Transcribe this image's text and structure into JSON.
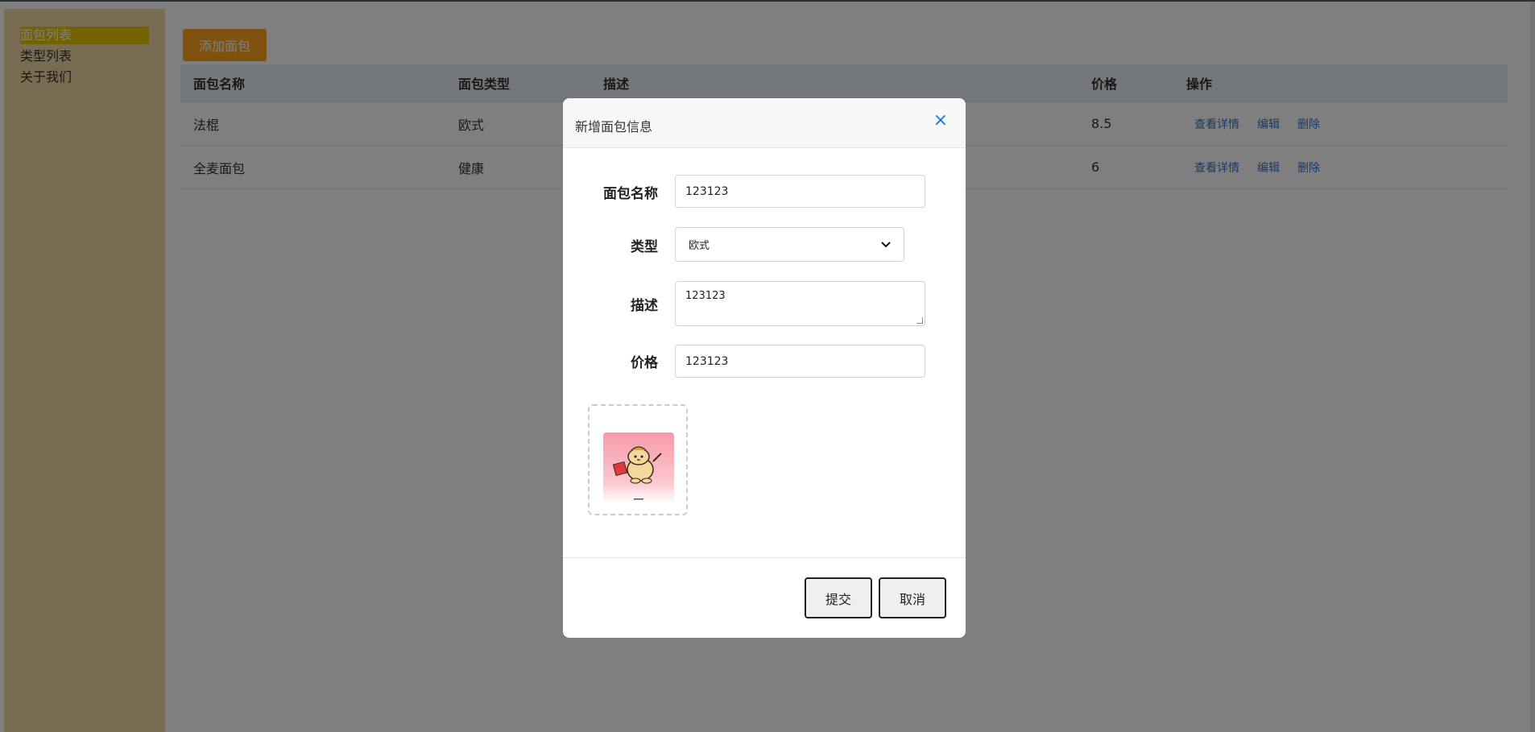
{
  "sidebar": {
    "items": [
      {
        "label": "面包列表",
        "active": true
      },
      {
        "label": "类型列表",
        "active": false
      },
      {
        "label": "关于我们",
        "active": false
      }
    ]
  },
  "toolbar": {
    "add_label": "添加面包"
  },
  "table": {
    "headers": [
      "面包名称",
      "面包类型",
      "描述",
      "价格",
      "操作"
    ],
    "rows": [
      {
        "name": "法棍",
        "type": "欧式",
        "desc": "",
        "price": "8.5"
      },
      {
        "name": "全麦面包",
        "type": "健康",
        "desc": "",
        "price": "6"
      }
    ],
    "actions": [
      "查看详情",
      "编辑",
      "删除"
    ]
  },
  "modal": {
    "title": "新增面包信息",
    "close_icon": "close-icon",
    "fields": {
      "name": {
        "label": "面包名称",
        "value": "123123"
      },
      "type": {
        "label": "类型",
        "value": "欧式"
      },
      "desc": {
        "label": "描述",
        "value": "123123"
      },
      "price": {
        "label": "价格",
        "value": "123123"
      }
    },
    "submit_label": "提交",
    "cancel_label": "取消"
  },
  "colors": {
    "accent": "#ffa21a",
    "sidebar_bg": "#f3d9a6",
    "link": "#2f74d4",
    "close": "#1a7ad9"
  }
}
